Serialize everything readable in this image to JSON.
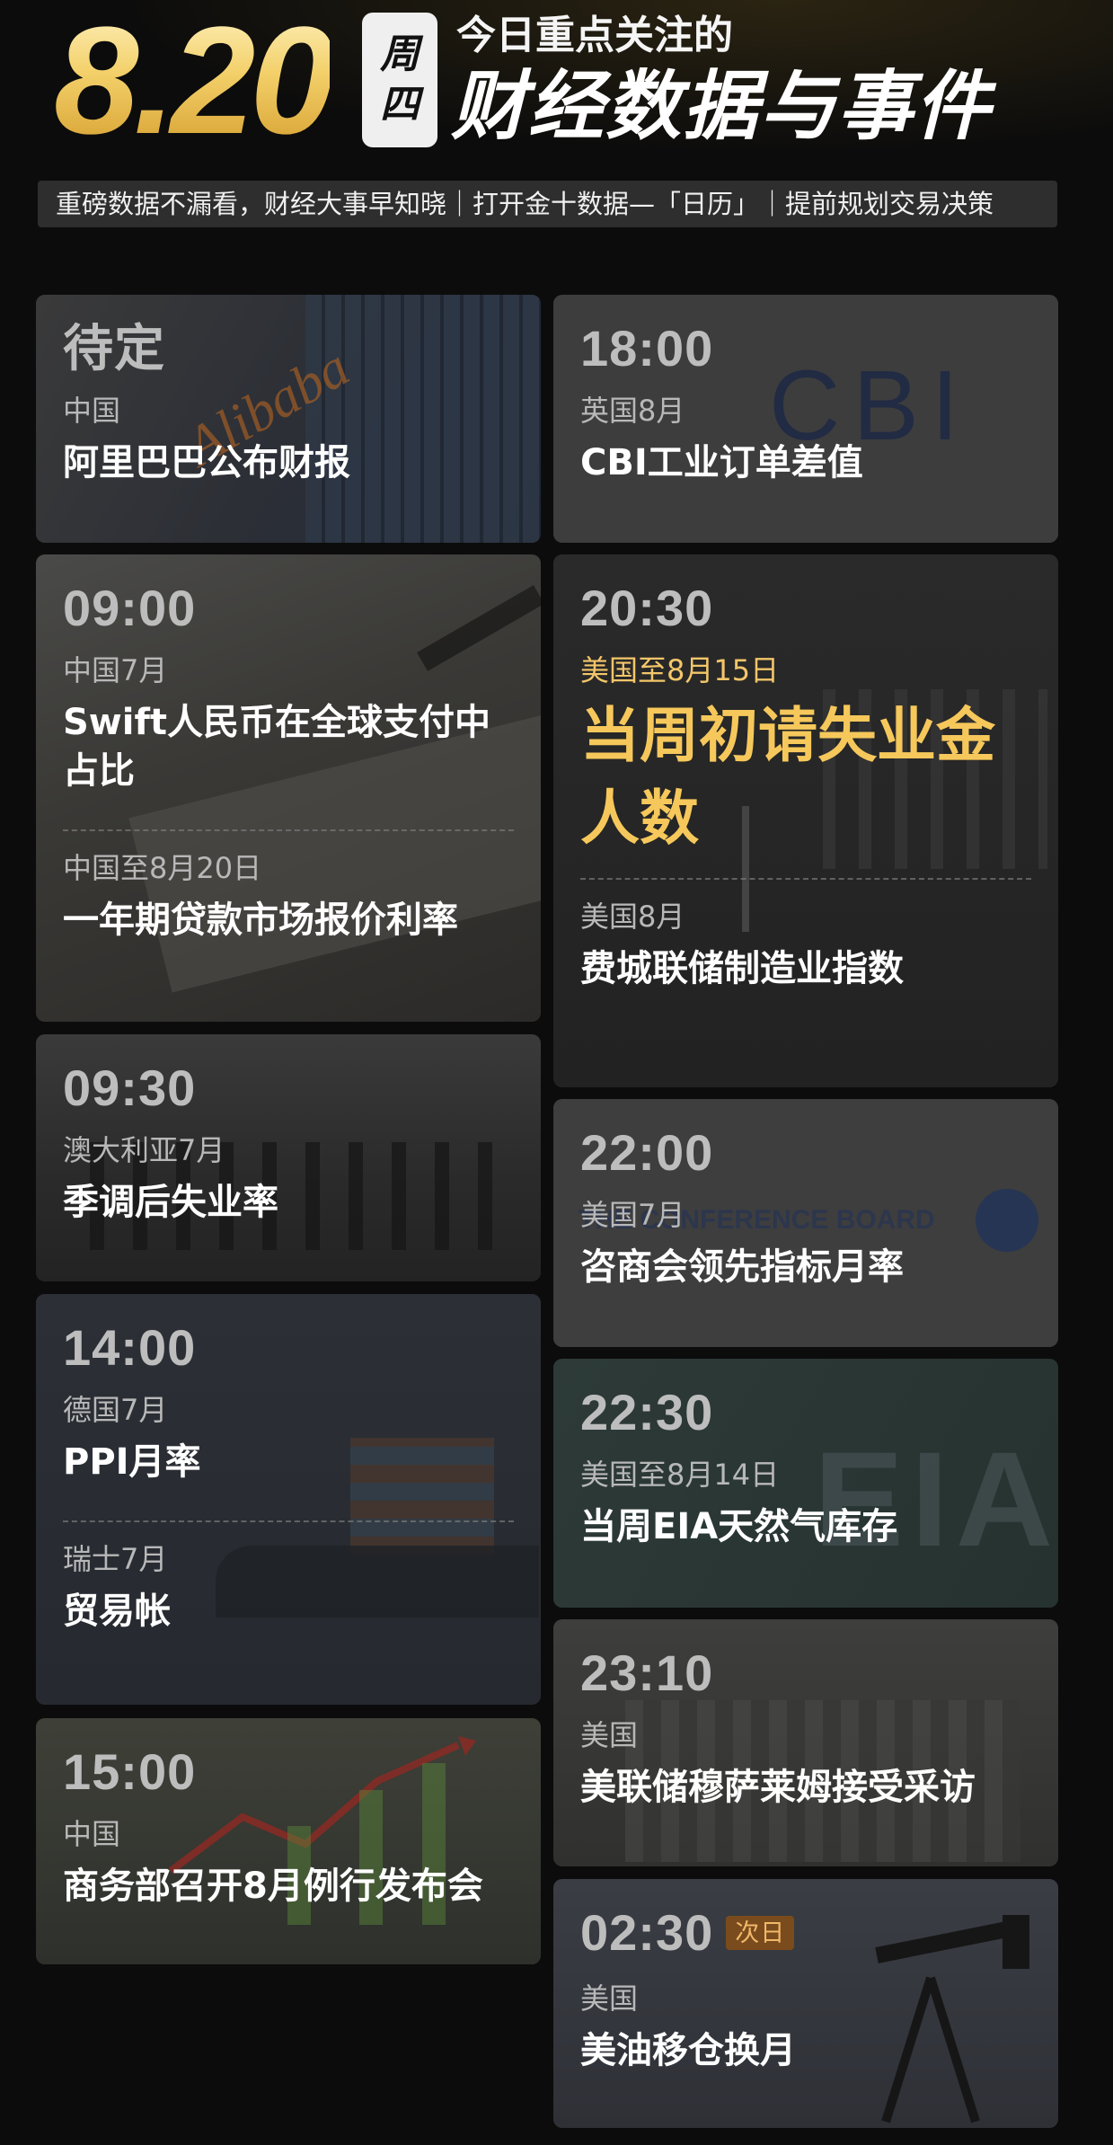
{
  "header": {
    "date": "8.20",
    "weekday_1": "周",
    "weekday_2": "四",
    "title_small": "今日重点关注的",
    "title_big": "财经数据与事件",
    "subtitle": "重磅数据不漏看，财经大事早知晓｜打开金十数据—「日历」｜提前规划交易决策"
  },
  "left": [
    {
      "time": "待定",
      "items": [
        {
          "region": "中国",
          "name": "阿里巴巴公布财报"
        }
      ],
      "bg_text": "Alibaba"
    },
    {
      "time": "09:00",
      "items": [
        {
          "region": "中国7月",
          "name": "Swift人民币在全球支付中占比"
        },
        {
          "region": "中国至8月20日",
          "name": "一年期贷款市场报价利率"
        }
      ]
    },
    {
      "time": "09:30",
      "items": [
        {
          "region": "澳大利亚7月",
          "name": "季调后失业率"
        }
      ]
    },
    {
      "time": "14:00",
      "items": [
        {
          "region": "德国7月",
          "name": "PPI月率"
        },
        {
          "region": "瑞士7月",
          "name": "贸易帐"
        }
      ]
    },
    {
      "time": "15:00",
      "items": [
        {
          "region": "中国",
          "name": "商务部召开8月例行发布会"
        }
      ]
    }
  ],
  "right": [
    {
      "time": "18:00",
      "items": [
        {
          "region": "英国8月",
          "name": "CBI工业订单差值"
        }
      ],
      "bg_text": "CBI"
    },
    {
      "time": "20:30",
      "items": [
        {
          "region": "美国至8月15日",
          "name": "当周初请失业金人数",
          "highlight": true
        },
        {
          "region": "美国8月",
          "name": "费城联储制造业指数"
        }
      ]
    },
    {
      "time": "22:00",
      "items": [
        {
          "region": "美国7月",
          "name": "咨商会领先指标月率"
        }
      ],
      "bg_text": "THE CONFERENCE BOARD"
    },
    {
      "time": "22:30",
      "items": [
        {
          "region": "美国至8月14日",
          "name": "当周EIA天然气库存"
        }
      ],
      "bg_text": "EIA"
    },
    {
      "time": "23:10",
      "items": [
        {
          "region": "美国",
          "name": "美联储穆萨莱姆接受采访"
        }
      ]
    },
    {
      "time": "02:30",
      "badge": "次日",
      "items": [
        {
          "region": "美国",
          "name": "美油移仓换月"
        }
      ]
    }
  ],
  "colors": {
    "accent_gold": "#f6c85b",
    "card_bg": "#262626",
    "badge_bg": "#7a4b1c"
  }
}
